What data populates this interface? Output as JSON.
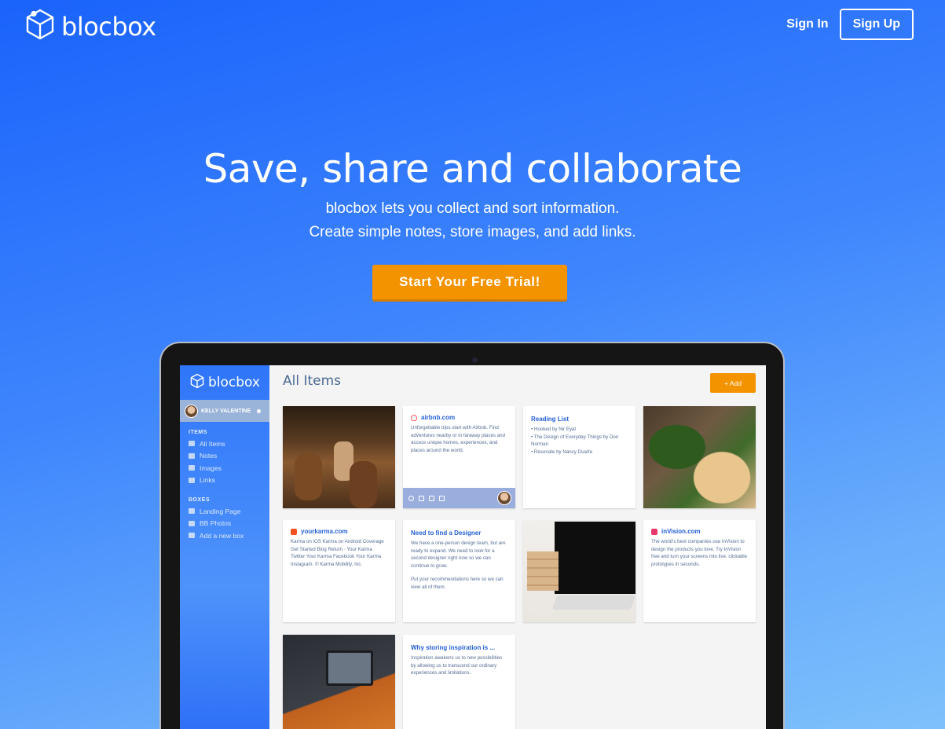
{
  "brand": {
    "name": "blocbox"
  },
  "nav": {
    "sign_in": "Sign In",
    "sign_up": "Sign Up"
  },
  "hero": {
    "title": "Save, share and collaborate",
    "subtitle_line1": "blocbox lets you collect and sort information.",
    "subtitle_line2": "Create simple notes, store images, and add links.",
    "cta": "Start Your Free Trial!"
  },
  "app": {
    "logo": "blocbox",
    "user": "KELLY VALENTINE",
    "items_header": "ITEMS",
    "items": [
      {
        "label": "All Items",
        "icon": "grid-icon"
      },
      {
        "label": "Notes",
        "icon": "note-icon"
      },
      {
        "label": "Images",
        "icon": "image-icon"
      },
      {
        "label": "Links",
        "icon": "link-icon"
      }
    ],
    "boxes_header": "BOXES",
    "boxes": [
      {
        "label": "Landing Page",
        "icon": "box-icon"
      },
      {
        "label": "BB Photos",
        "icon": "box-icon"
      },
      {
        "label": "Add a new box",
        "icon": "plus-icon"
      }
    ],
    "page_title": "All Items",
    "add_button": "+ Add",
    "cards": {
      "airbnb": {
        "title": "airbnb.com",
        "body": "Unforgettable trips start with Airbnb. Find adventures nearby or in faraway places and access unique homes, experiences, and places around the world."
      },
      "reading": {
        "title": "Reading List",
        "items": [
          "Hooked by Nir Eyal",
          "The Design of Everyday Things by Don Norman",
          "Resonate by Nancy Duarte"
        ]
      },
      "karma": {
        "title": "yourkarma.com",
        "body": "Karma on iOS Karma on Android Coverage Get Started Blog Return · Your Karma Twitter Your Karma Facebook Your Karma Instagram. © Karma Mobility, Inc."
      },
      "designer": {
        "title": "Need to find a Designer",
        "body1": "We have a one-person design team, but are ready to expand. We need to look for a second designer right now so we can continue to grow.",
        "body2": "Put your recommendations here so we can view all of them."
      },
      "invision": {
        "title": "inVision.com",
        "body": "The world's best companies use InVision to design the products you love. Try InVision free and turn your screens into live, clickable prototypes in seconds."
      },
      "inspiration": {
        "title": "Why storing inspiration is ...",
        "body": "Inspiration awakens us to new possibilities by allowing us to transcend our ordinary experiences and limitations."
      }
    }
  },
  "colors": {
    "accent": "#f49300",
    "brand_blue": "#2560d5"
  }
}
